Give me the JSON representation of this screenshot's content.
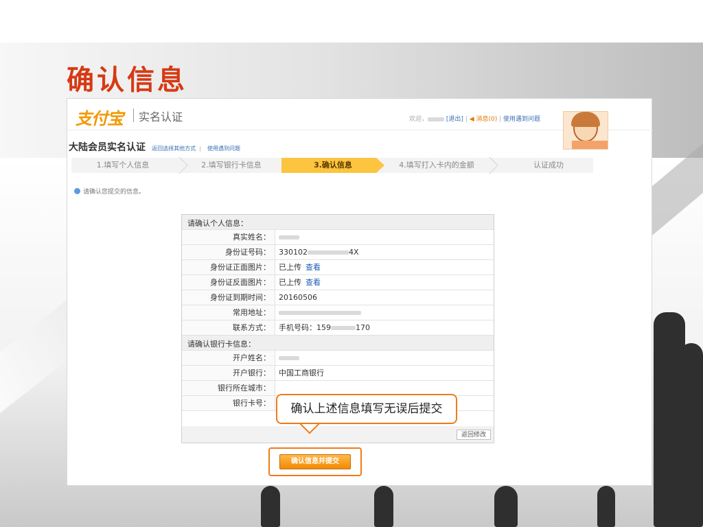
{
  "slide": {
    "title": "确认信息"
  },
  "header": {
    "logo": "支付宝",
    "app_title": "实名认证",
    "welcome": "欢迎，",
    "logout": "[退出]",
    "messages": "消息(0)",
    "help": "使用遇到问题"
  },
  "page": {
    "title": "大陆会员实名认证",
    "link_other": "返回选择其他方式",
    "link_help": "使用遇到问题"
  },
  "steps": [
    "1.填写个人信息",
    "2.填写银行卡信息",
    "3.确认信息",
    "4.填写打入卡内的金额",
    "认证成功"
  ],
  "active_step": 3,
  "notice": "请确认您提交的信息。",
  "personal": {
    "section_title": "请确认个人信息：",
    "real_name_label": "真实姓名：",
    "id_number_label": "身份证号码：",
    "id_number_prefix": "330102",
    "id_number_suffix": "4X",
    "id_front_label": "身份证正面图片：",
    "id_back_label": "身份证反面图片：",
    "uploaded": "已上传",
    "view": "查看",
    "expiry_label": "身份证到期时间：",
    "expiry_value": "20160506",
    "address_label": "常用地址：",
    "contact_label": "联系方式：",
    "phone_prefix": "手机号码：159",
    "phone_suffix": "170"
  },
  "bank": {
    "section_title": "请确认银行卡信息：",
    "holder_label": "开户姓名：",
    "bank_label": "开户银行：",
    "bank_value": "中国工商银行",
    "city_label": "银行所在城市：",
    "card_label": "银行卡号："
  },
  "buttons": {
    "back": "返回修改",
    "submit": "确认信息并提交"
  },
  "callout": "确认上述信息填写无误后提交",
  "colors": {
    "accent": "#ef7b17",
    "title_red": "#d63a14",
    "step_active": "#fcc43f",
    "link": "#1b5fb4"
  }
}
